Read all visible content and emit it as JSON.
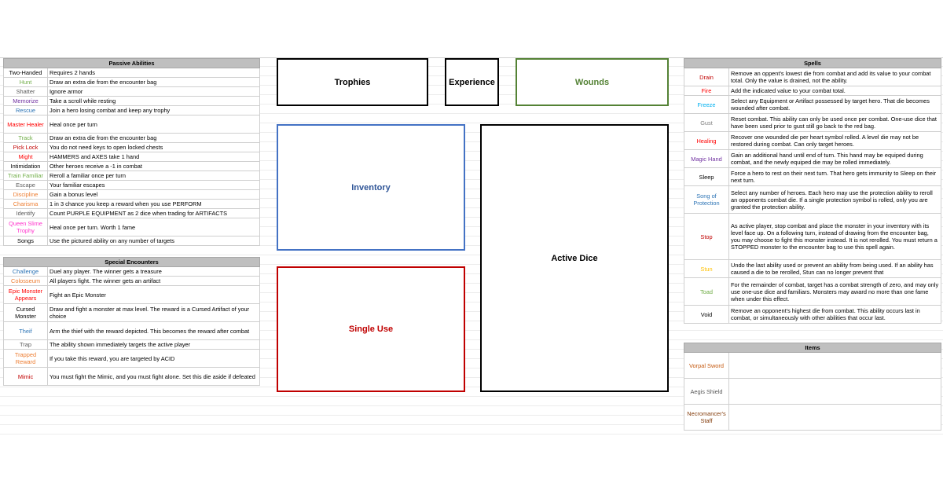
{
  "passive": {
    "title": "Passive Abilities",
    "rows": [
      {
        "name": "Two-Handed",
        "color": "#000000",
        "text": "Requires 2 hands"
      },
      {
        "name": "Hunt",
        "color": "#70ad47",
        "text": "Draw an extra die from the encounter bag"
      },
      {
        "name": "Shatter",
        "color": "#595959",
        "text": "Ignore armor"
      },
      {
        "name": "Memorize",
        "color": "#7030a0",
        "text": "Take a scroll while resting"
      },
      {
        "name": "Rescue",
        "color": "#2e75b6",
        "text": "Join a hero losing combat and keep any trophy"
      },
      {
        "name": "Master Healer",
        "color": "#ff0000",
        "text": "Heal once per turn"
      },
      {
        "name": "Track",
        "color": "#70ad47",
        "text": "Draw an extra die from the encounter bag"
      },
      {
        "name": "Pick Lock",
        "color": "#c00000",
        "text": "You do not need keys to open locked chests"
      },
      {
        "name": "Might",
        "color": "#ff0000",
        "text": "HAMMERS and AXES take 1 hand"
      },
      {
        "name": "Intimidation",
        "color": "#000000",
        "text": "Other heroes receive a -1 in combat"
      },
      {
        "name": "Train Familiar",
        "color": "#70ad47",
        "text": "Reroll a familiar once per turn"
      },
      {
        "name": "Escape",
        "color": "#595959",
        "text": "Your familiar escapes"
      },
      {
        "name": "Discipline",
        "color": "#ed7d31",
        "text": "Gain a bonus level"
      },
      {
        "name": "Charisma",
        "color": "#ed7d31",
        "text": "1 in 3 chance you keep a reward when you use PERFORM"
      },
      {
        "name": "Identify",
        "color": "#595959",
        "text": "Count PURPLE EQUIPMENT as 2 dice when trading for ARTIFACTS"
      },
      {
        "name": "Queen Slime Trophy",
        "color": "#ff33cc",
        "text": "Heal once per turn. Worth 1 fame"
      },
      {
        "name": "Songs",
        "color": "#000000",
        "text": "Use the pictured ability on any number of targets"
      }
    ]
  },
  "special": {
    "title": "Special Encounters",
    "rows": [
      {
        "name": "Challenge",
        "color": "#2e75b6",
        "text": "Duel any player. The winner gets a treasure"
      },
      {
        "name": "Colosseum",
        "color": "#ed7d31",
        "text": "All players fight. The winner gets an artifact"
      },
      {
        "name": "Epic Monster Appears",
        "color": "#ff0000",
        "text": "Fight an Epic Monster"
      },
      {
        "name": "Cursed Monster",
        "color": "#000000",
        "text": "Draw and fight a monster at max level. The reward is a Cursed Artifact of your choice"
      },
      {
        "name": "Theif",
        "color": "#2e75b6",
        "text": "Arm the thief with the reward depicted. This becomes the reward after combat"
      },
      {
        "name": "Trap",
        "color": "#595959",
        "text": "The ability shown immediately targets the active player"
      },
      {
        "name": "Trapped Reward",
        "color": "#ed7d31",
        "text": "If you take this reward, you are targeted by ACID"
      },
      {
        "name": "Mimic",
        "color": "#c00000",
        "text": "You must fight the Mimic, and you must fight alone. Set this die aside if defeated"
      }
    ]
  },
  "board": {
    "trophies": "Trophies",
    "experience": "Experience",
    "wounds": "Wounds",
    "inventory": "Inventory",
    "active_dice": "Active Dice",
    "single_use": "Single Use"
  },
  "spells": {
    "title": "Spells",
    "rows": [
      {
        "name": "Drain",
        "color": "#c00000",
        "text": "Remove an oppent's lowest die from combat and add its value to your combat total. Only the value is drained, not the ability."
      },
      {
        "name": "Fire",
        "color": "#ff0000",
        "text": "Add the indicated value to your combat total."
      },
      {
        "name": "Freeze",
        "color": "#00b0f0",
        "text": "Select any Equipment or Artifact possessed by target hero. That die becomes wounded after combat."
      },
      {
        "name": "Gust",
        "color": "#808080",
        "text": "Reset combat. This ability can only be used once per combat. One-use dice that have been used prior to gust still go back to the red bag."
      },
      {
        "name": "Healing",
        "color": "#ff0000",
        "text": "Recover one wounded die per heart symbol rolled. A level die may not be restored during combat. Can only target heroes."
      },
      {
        "name": "Magic Hand",
        "color": "#7030a0",
        "text": "Gain an additional hand until end of turn. This hand may be equiped during combat, and the newly equiped die may be rolled immediately."
      },
      {
        "name": "Sleep",
        "color": "#000000",
        "text": "Force a hero to rest on their next turn. That hero gets immunity to Sleep on their next turn."
      },
      {
        "name": "Song of Protection",
        "color": "#2e75b6",
        "text": "Select any number of heroes. Each hero may use the protection ability to reroll an opponents combat die. If a single protection symbol is rolled, only you are granted the protection ability."
      },
      {
        "name": "Stop",
        "color": "#c00000",
        "text": "As active player, stop combat and place the monster in your inventory with its level face up. On a following turn, instead of drawing from the encounter bag, you may choose to fight this monster instead. It is not rerolled. You must return a STOPPED monster to the encounter bag to use this spell again."
      },
      {
        "name": "Stun",
        "color": "#ffc000",
        "text": "Undo the last ability used or prevent an ability from being used. If an ability has caused a die to be rerolled, Stun can no longer prevent that"
      },
      {
        "name": "Toad",
        "color": "#70ad47",
        "text": "For the remainder of combat, target has a combat strength of zero, and may only use one-use dice and familiars. Monsters may award no more than one fame when under this effect."
      },
      {
        "name": "Void",
        "color": "#000000",
        "text": "Remove an opponent's highest die from combat. This ability occurs last in combat, or simultaneously with other abilities that occur last."
      }
    ]
  },
  "items": {
    "title": "Items",
    "rows": [
      {
        "name": "Vorpal Sword",
        "color": "#c55a11",
        "text": ""
      },
      {
        "name": "Aegis Shield",
        "color": "#595959",
        "text": ""
      },
      {
        "name": "Necromancer's Staff",
        "color": "#833c0b",
        "text": ""
      }
    ]
  }
}
